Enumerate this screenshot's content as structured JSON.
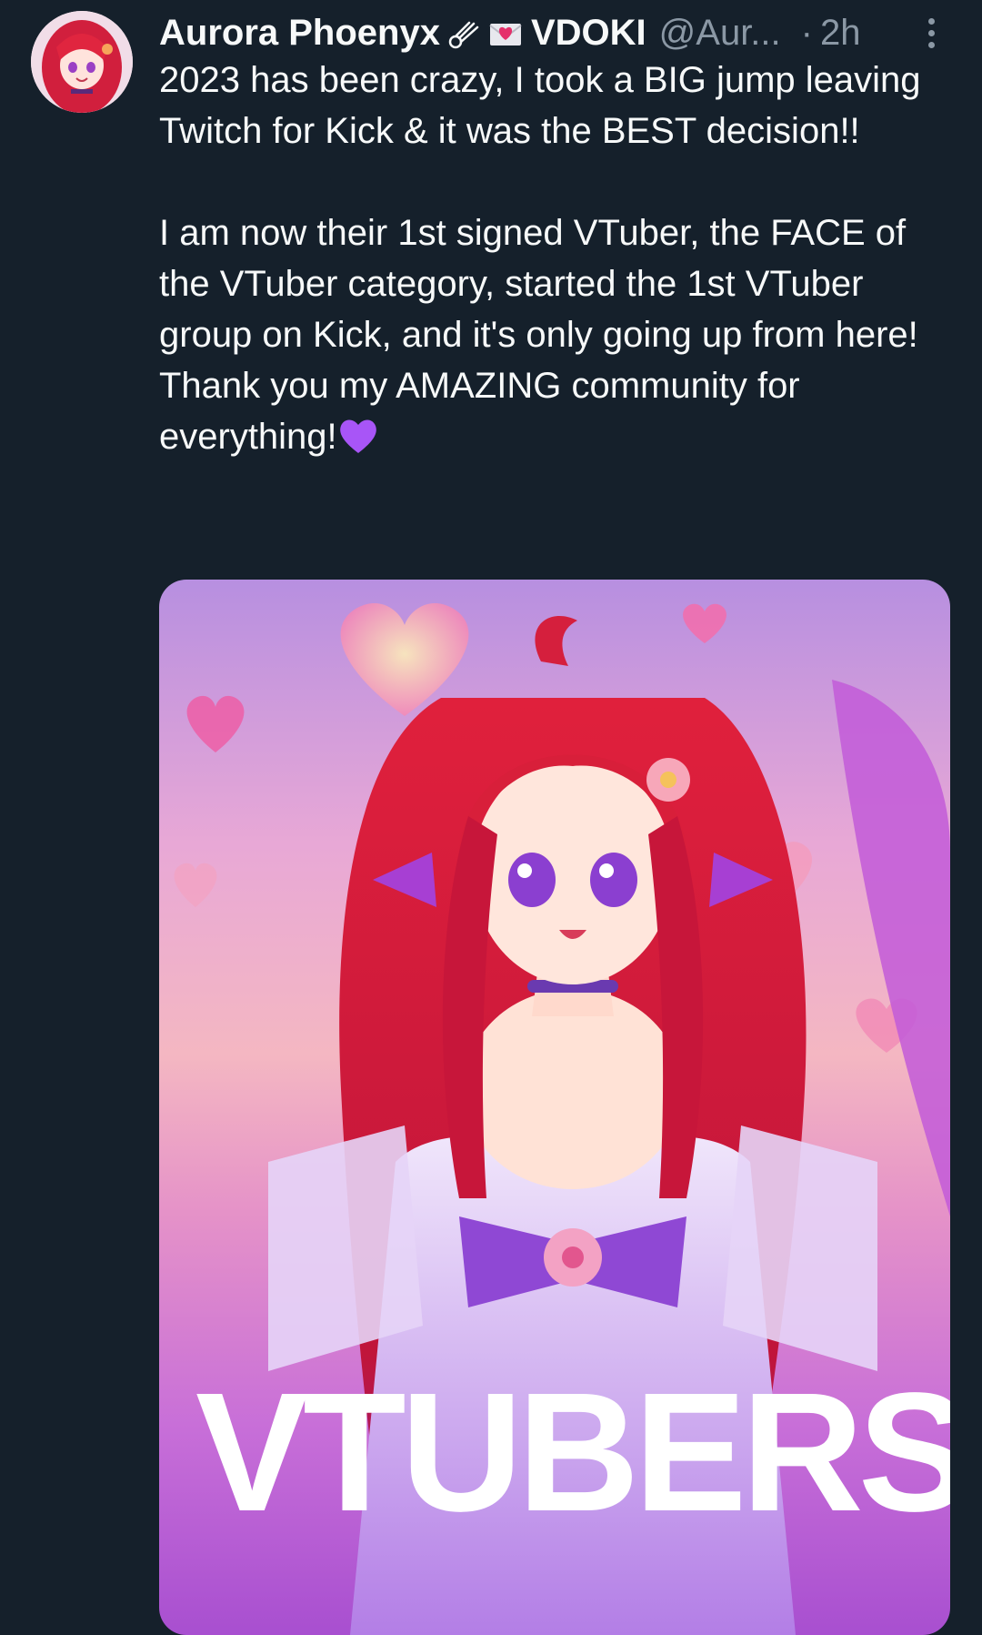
{
  "tweet": {
    "author": {
      "display_name": "Aurora Phoenyx",
      "name_suffix": "VDOKI",
      "badge_icons": [
        "comet-icon",
        "love-letter-icon"
      ],
      "handle": "@Aur...",
      "avatar_icon": "avatar-anime-girl"
    },
    "separator": "·",
    "time": "2h",
    "more_icon": "more-vertical-icon",
    "text": {
      "line1": "2023 has been crazy, I took a BIG jump leaving Twitch for Kick & it was the BEST decision!!",
      "line2": "I am now their 1st signed VTuber, the FACE of the VTuber category, started the 1st VTuber group on Kick, and it's only going up from here!",
      "line3": "Thank you my AMAZING community for everything!",
      "trailing_emoji": "purple-heart-icon"
    },
    "media": {
      "overlay_text": "VTUBERS"
    }
  },
  "colors": {
    "background": "#15202b",
    "text_primary": "#f7f9f9",
    "text_secondary": "#8b98a5",
    "heart": "#a855f7"
  }
}
